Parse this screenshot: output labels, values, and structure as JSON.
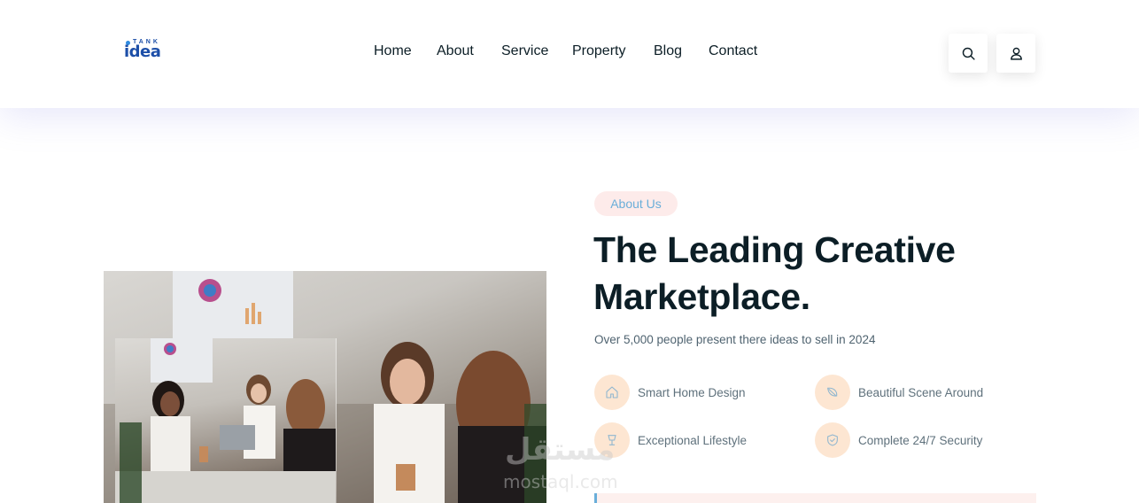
{
  "header": {
    "logo": {
      "top_text": "TANK",
      "main_text": "idea"
    },
    "nav": [
      "Home",
      "About",
      "Service",
      "Property",
      "Blog",
      "Contact"
    ],
    "icons": [
      "search-icon",
      "user-icon"
    ]
  },
  "about": {
    "tag": "About Us",
    "headline_line1": "The Leading Creative",
    "headline_line2": "Marketplace.",
    "subtext": "Over 5,000 people present there ideas to sell in 2024",
    "features": [
      {
        "label": "Smart Home Design",
        "icon": "home-icon"
      },
      {
        "label": "Beautiful Scene Around",
        "icon": "leaf-icon"
      },
      {
        "label": "Exceptional Lifestyle",
        "icon": "cup-icon"
      },
      {
        "label": "Complete 24/7 Security",
        "icon": "shield-icon"
      }
    ]
  },
  "watermark": {
    "arabic": "مستقل",
    "url": "mostaql.com"
  },
  "colors": {
    "brand_blue": "#1d4fa8",
    "accent_peach": "#fde6d2",
    "tag_bg": "#fdebea",
    "tag_text": "#6aaed9",
    "headline": "#0c1e26"
  }
}
